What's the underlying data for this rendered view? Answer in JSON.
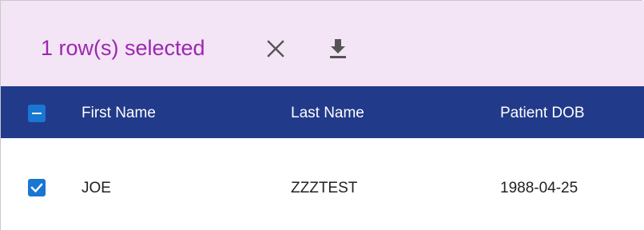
{
  "toolbar": {
    "selection_text": "1 row(s) selected",
    "accent_color": "#9c27b0",
    "background_color": "#f3e5f5",
    "close_icon": "close-icon",
    "download_icon": "download-icon"
  },
  "table": {
    "header_color": "#213a8a",
    "checkbox_color": "#1976d2",
    "header_checkbox_state": "indeterminate",
    "columns": [
      "First Name",
      "Last Name",
      "Patient DOB"
    ],
    "rows": [
      {
        "selected": true,
        "cells": [
          "JOE",
          "ZZZTEST",
          "1988-04-25"
        ]
      }
    ]
  }
}
